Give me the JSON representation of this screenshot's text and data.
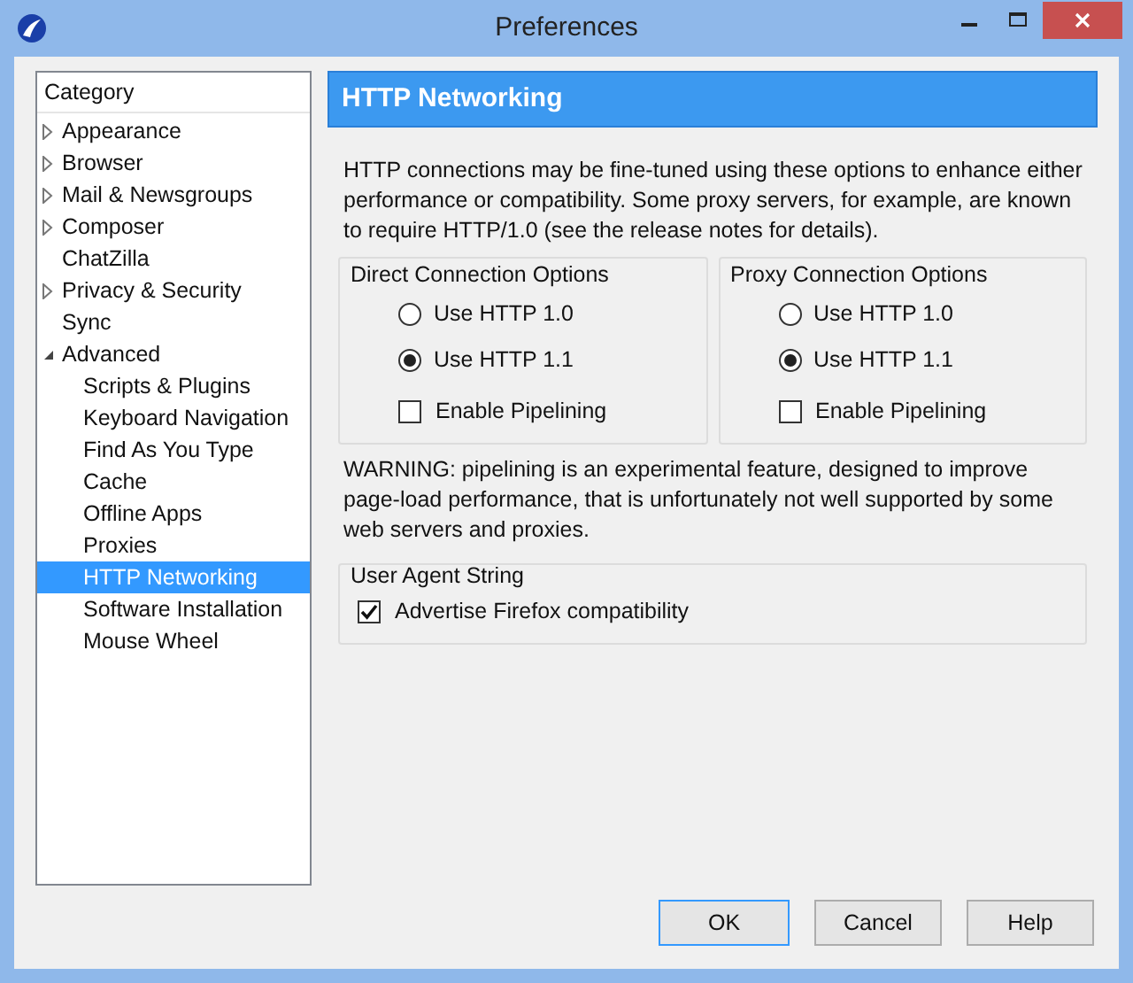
{
  "window": {
    "title": "Preferences"
  },
  "sidebar": {
    "header": "Category",
    "items": [
      {
        "label": "Appearance",
        "kind": "folder",
        "expanded": false,
        "selected": false
      },
      {
        "label": "Browser",
        "kind": "folder",
        "expanded": false,
        "selected": false
      },
      {
        "label": "Mail & Newsgroups",
        "kind": "folder",
        "expanded": false,
        "selected": false
      },
      {
        "label": "Composer",
        "kind": "folder",
        "expanded": false,
        "selected": false
      },
      {
        "label": "ChatZilla",
        "kind": "leaf",
        "selected": false
      },
      {
        "label": "Privacy & Security",
        "kind": "folder",
        "expanded": false,
        "selected": false
      },
      {
        "label": "Sync",
        "kind": "leaf",
        "selected": false
      },
      {
        "label": "Advanced",
        "kind": "folder",
        "expanded": true,
        "selected": false,
        "children": [
          {
            "label": "Scripts & Plugins",
            "kind": "leaf",
            "selected": false
          },
          {
            "label": "Keyboard Navigation",
            "kind": "leaf",
            "selected": false
          },
          {
            "label": "Find As You Type",
            "kind": "leaf",
            "selected": false
          },
          {
            "label": "Cache",
            "kind": "leaf",
            "selected": false
          },
          {
            "label": "Offline Apps",
            "kind": "leaf",
            "selected": false
          },
          {
            "label": "Proxies",
            "kind": "leaf",
            "selected": false
          },
          {
            "label": "HTTP Networking",
            "kind": "leaf",
            "selected": true
          },
          {
            "label": "Software Installation",
            "kind": "leaf",
            "selected": false
          },
          {
            "label": "Mouse Wheel",
            "kind": "leaf",
            "selected": false
          }
        ]
      }
    ]
  },
  "panel": {
    "title": "HTTP Networking",
    "intro": "HTTP connections may be fine-tuned using these options to enhance either performance or compatibility. Some proxy servers, for example, are known to require HTTP/1.0 (see the release notes for details).",
    "groups": [
      {
        "title": "Direct Connection Options",
        "radios": [
          {
            "label": "Use HTTP 1.0",
            "selected": false
          },
          {
            "label": "Use HTTP 1.1",
            "selected": true
          }
        ],
        "checkbox": {
          "label": "Enable Pipelining",
          "checked": false
        }
      },
      {
        "title": "Proxy Connection Options",
        "radios": [
          {
            "label": "Use HTTP 1.0",
            "selected": false
          },
          {
            "label": "Use HTTP 1.1",
            "selected": true
          }
        ],
        "checkbox": {
          "label": "Enable Pipelining",
          "checked": false
        }
      }
    ],
    "warning": "WARNING: pipelining is an experimental feature, designed to improve page-load performance, that is unfortunately not well supported by some web servers and proxies.",
    "user_agent": {
      "title": "User Agent String",
      "checkbox": {
        "label": "Advertise Firefox compatibility",
        "checked": true
      }
    }
  },
  "buttons": [
    "OK",
    "Cancel",
    "Help"
  ]
}
